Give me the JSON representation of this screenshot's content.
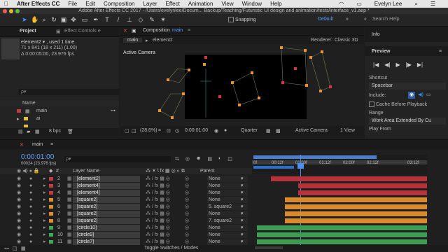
{
  "menubar": {
    "apple": "",
    "app_name": "After Effects CC",
    "items": [
      "File",
      "Edit",
      "Composition",
      "Layer",
      "Effect",
      "Animation",
      "View",
      "Window",
      "Help"
    ],
    "user": "Evelyn Lee"
  },
  "window_title": "Adobe After Effects CC 2017 - /Users/evelynlee/Docum... Backup/Teaching/Futuristic UI design and animation/tests/interface_v1.aep *",
  "toolbar": {
    "snapping_label": "Snapping",
    "workspace": "Default",
    "search_placeholder": "Search Help"
  },
  "project_panel": {
    "tab_project": "Project",
    "tab_effects": "Effect Controls e",
    "selected_item": "element2 ▾ , used 1 time",
    "info_line1": "71 x 841  (18 x 211) (1.00)",
    "info_line2": "Δ 0:00:05:00, 23.976 fps",
    "search_placeholder": "ρ▾",
    "col_name": "Name",
    "items": [
      {
        "name": "main",
        "color": "#c23a44"
      },
      {
        "name": "ai",
        "color": "#e0c040"
      },
      {
        "name": "...",
        "color": "#e0c040"
      }
    ],
    "bpc": "8 bpc"
  },
  "viewer": {
    "tab_label": "Composition",
    "tab_name": "main",
    "breadcrumb_main": "main",
    "breadcrumb_el": "element2",
    "renderer_label": "Renderer:",
    "renderer_value": "Classic 3D",
    "camera_label": "Active Camera",
    "zoom": "(28.6%)",
    "timecode": "0:00:01:00",
    "quality": "Quarter",
    "camera_select": "Active Camera",
    "views": "1 View"
  },
  "right_panel": {
    "info_tab": "Info",
    "preview_tab": "Preview",
    "shortcut_label": "Shortcut",
    "shortcut_value": "Spacebar",
    "include_label": "Include:",
    "cache_label": "Cache Before Playback",
    "range_label": "Range",
    "range_value": "Work Area Extended By Cu",
    "play_from": "Play From"
  },
  "timeline": {
    "tab_name": "main",
    "timecode": "0:00:01:00",
    "frames": "00024 (23.976 fps)",
    "search_placeholder": "ρ▾",
    "col_layer_name": "Layer Name",
    "col_parent": "Parent",
    "ruler_labels": [
      "0f",
      "00:12f",
      "01:00f",
      "01:12f",
      "02:00f",
      "02:12f",
      "03:12f"
    ],
    "footer": "Toggle Switches / Modes",
    "layers": [
      {
        "num": "2",
        "name": "[element2]",
        "color": "#c23a44",
        "parent": "None",
        "bar_color": "#b8323c",
        "bar_start": 0.1
      },
      {
        "num": "3",
        "name": "[element4]",
        "color": "#c23a44",
        "parent": "None",
        "bar_color": "#b8323c",
        "bar_start": 0.26
      },
      {
        "num": "4",
        "name": "[element4]",
        "color": "#c23a44",
        "parent": "None",
        "bar_color": "#b8323c",
        "bar_start": 0.26
      },
      {
        "num": "5",
        "name": "[square2]",
        "color": "#e0902a",
        "parent": "None",
        "bar_color": "#d88a2c",
        "bar_start": 0.18
      },
      {
        "num": "6",
        "name": "[square2]",
        "color": "#e0902a",
        "parent": "5. square2",
        "bar_color": "#d88a2c",
        "bar_start": 0.18
      },
      {
        "num": "7",
        "name": "[square2]",
        "color": "#e0902a",
        "parent": "None",
        "bar_color": "#d88a2c",
        "bar_start": 0.18
      },
      {
        "num": "8",
        "name": "[square2]",
        "color": "#e0902a",
        "parent": "7. square2",
        "bar_color": "#d88a2c",
        "bar_start": 0.18
      },
      {
        "num": "9",
        "name": "[circle10]",
        "color": "#3fa85a",
        "parent": "None",
        "bar_color": "#3f9c52",
        "bar_start": 0.02
      },
      {
        "num": "10",
        "name": "[circle9]",
        "color": "#3fa85a",
        "parent": "None",
        "bar_color": "#3f9c52",
        "bar_start": 0.02
      },
      {
        "num": "11",
        "name": "[circle7]",
        "color": "#3fa85a",
        "parent": "None",
        "bar_color": "#3f9c52",
        "bar_start": 0.02
      }
    ]
  }
}
